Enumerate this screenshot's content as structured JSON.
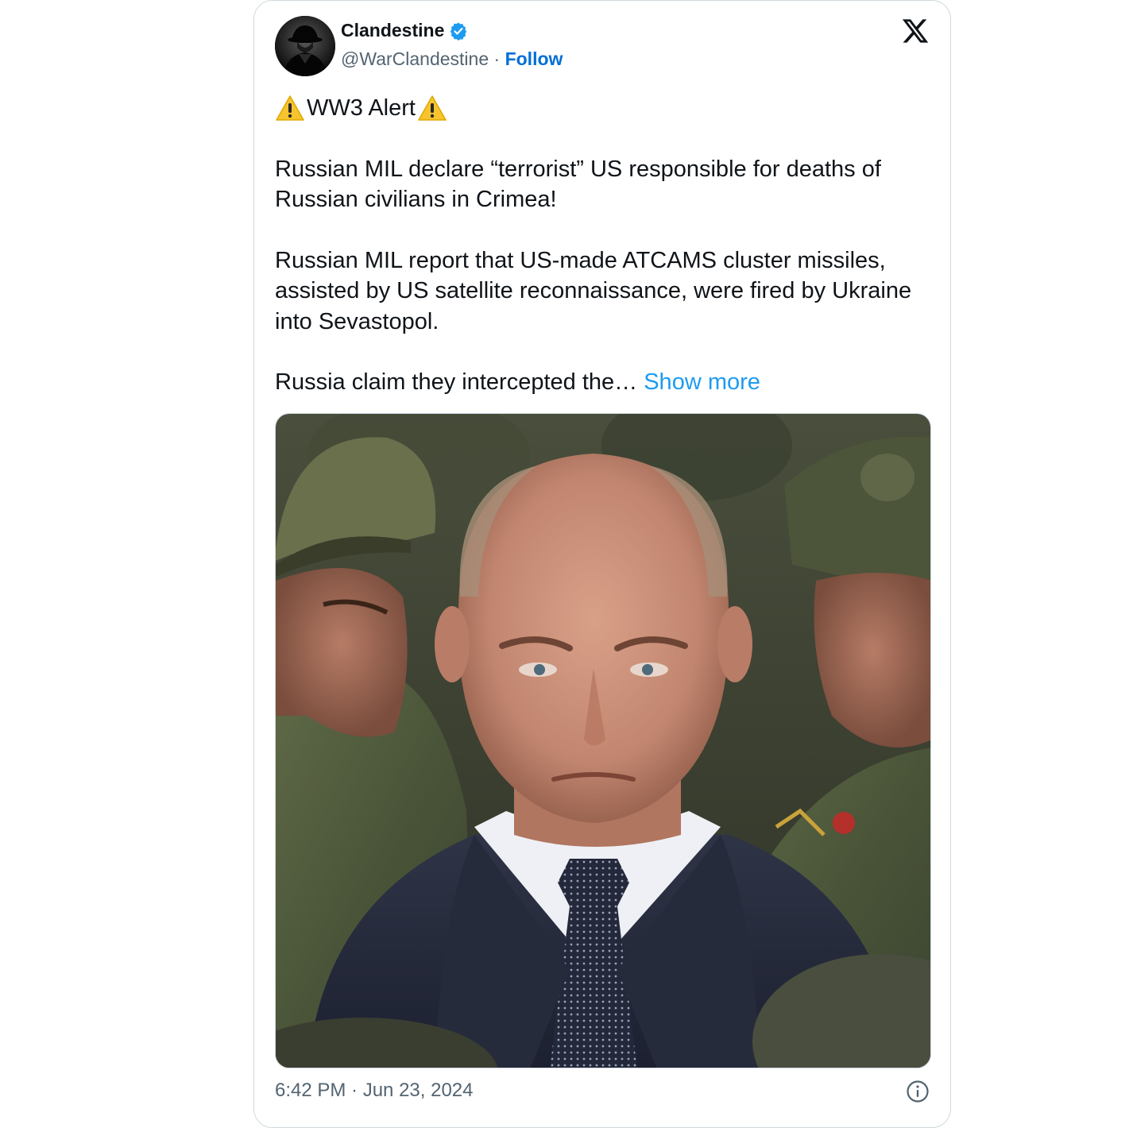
{
  "tweet": {
    "author": {
      "display_name": "Clandestine",
      "handle": "@WarClandestine",
      "separator": " · ",
      "follow_label": "Follow",
      "verified_icon": "verified-badge-icon",
      "avatar_icon": "spy-silhouette-avatar"
    },
    "platform_logo": "x-logo-icon",
    "text": {
      "alert_label": "WW3 Alert",
      "alert_icon": "warning-icon",
      "paragraph_1": "Russian MIL declare “terrorist” US responsible for deaths of Russian civilians in Crimea!",
      "paragraph_2": "Russian MIL report that US-made ATCAMS cluster missiles, assisted by US satellite reconnaissance, were fired by Ukraine into Sevastopol.",
      "paragraph_3_truncated": "Russia claim they intercepted the… ",
      "show_more_label": "Show more"
    },
    "media": {
      "description_icon": "photo-man-in-suit-with-soldiers"
    },
    "timestamp": "6:42 PM · Jun 23, 2024",
    "info_icon": "info-icon"
  },
  "colors": {
    "text_primary": "#0f1419",
    "text_secondary": "#536471",
    "link_blue": "#1d9bf0",
    "follow_blue": "#006fd6",
    "border": "#cfd9de",
    "verified_blue": "#1d9bf0"
  }
}
